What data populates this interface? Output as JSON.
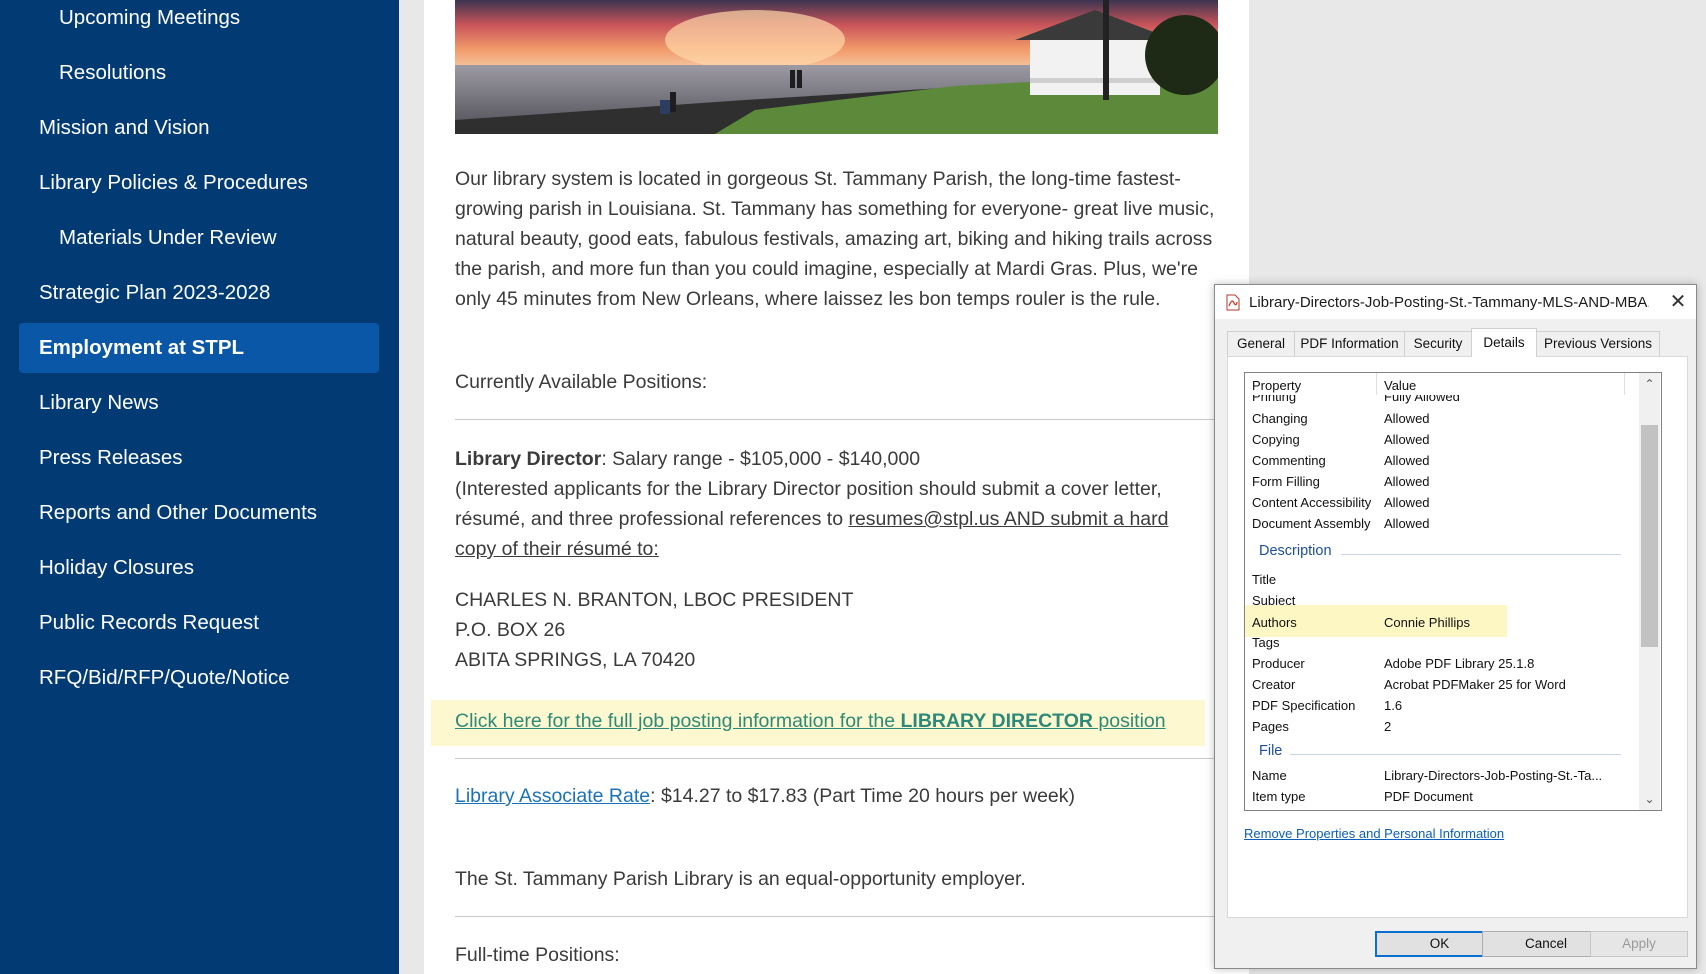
{
  "sidebar": {
    "items": [
      {
        "label": "Upcoming Meetings"
      },
      {
        "label": "Resolutions"
      },
      {
        "label": "Mission and Vision"
      },
      {
        "label": "Library Policies & Procedures"
      },
      {
        "label": "Materials Under Review"
      },
      {
        "label": "Strategic Plan 2023-2028"
      },
      {
        "label": "Employment at STPL"
      },
      {
        "label": "Library News"
      },
      {
        "label": "Press Releases"
      },
      {
        "label": "Reports and Other Documents"
      },
      {
        "label": "Holiday Closures"
      },
      {
        "label": "Public Records Request"
      },
      {
        "label": "RFQ/Bid/RFP/Quote/Notice"
      }
    ]
  },
  "content": {
    "intro": "Our library system is located in gorgeous St. Tammany Parish, the long-time fastest-growing parish in Louisiana. St. Tammany has something for everyone- great live music, natural beauty, good eats, fabulous festivals, amazing art, biking and hiking trails across the parish, and more fun than you could imagine, especially at Mardi Gras. Plus, we're only 45 minutes from New Orleans, where laissez les bon temps rouler is the rule.",
    "positions_heading": "Currently Available Positions:",
    "director": {
      "title": "Library Director",
      "salary": ": Salary range - $105,000 - $140,000",
      "instructions_pre": "(Interested applicants for the Library Director position should submit a cover letter, résumé, and three professional references to ",
      "instructions_link": "resumes@stpl.us AND submit a hard copy of their résumé to:",
      "address": [
        "CHARLES N. BRANTON, LBOC PRESIDENT",
        "P.O. BOX 26",
        "ABITA SPRINGS, LA 70420"
      ]
    },
    "job_link": {
      "pre": "Click here for the full job posting information for the ",
      "bold": "LIBRARY DIRECTOR",
      "post": " position"
    },
    "associate": {
      "link": "Library Associate Rate",
      "text": ": $14.27 to $17.83 (Part Time 20 hours per week)"
    },
    "eeo": "The St. Tammany Parish Library is an equal-opportunity employer.",
    "fulltime_heading": "Full-time Positions:"
  },
  "dialog": {
    "title": "Library-Directors-Job-Posting-St.-Tammany-MLS-AND-MBA...",
    "close": "✕",
    "tabs": [
      "General",
      "PDF Information",
      "Security",
      "Details",
      "Previous Versions"
    ],
    "active_tab": "Details",
    "columns": {
      "property": "Property",
      "value": "Value"
    },
    "rows": [
      {
        "k": "Printing",
        "v": "Fully Allowed"
      },
      {
        "k": "Changing",
        "v": "Allowed"
      },
      {
        "k": "Copying",
        "v": "Allowed"
      },
      {
        "k": "Commenting",
        "v": "Allowed"
      },
      {
        "k": "Form Filling",
        "v": "Allowed"
      },
      {
        "k": "Content Accessibility",
        "v": "Allowed"
      },
      {
        "k": "Document Assembly",
        "v": "Allowed"
      }
    ],
    "section_description": "Description",
    "desc_rows": [
      {
        "k": "Title",
        "v": ""
      },
      {
        "k": "Subject",
        "v": ""
      },
      {
        "k": "Authors",
        "v": "Connie Phillips"
      },
      {
        "k": "Tags",
        "v": ""
      },
      {
        "k": "Producer",
        "v": "Adobe PDF Library 25.1.8"
      },
      {
        "k": "Creator",
        "v": "Acrobat PDFMaker 25 for Word"
      },
      {
        "k": "PDF Specification",
        "v": "1.6"
      },
      {
        "k": "Pages",
        "v": "2"
      }
    ],
    "section_file": "File",
    "file_rows": [
      {
        "k": "Name",
        "v": "Library-Directors-Job-Posting-St.-Ta..."
      },
      {
        "k": "Item type",
        "v": "PDF Document"
      }
    ],
    "remove_link": "Remove Properties and Personal Information",
    "buttons": {
      "ok": "OK",
      "cancel": "Cancel",
      "apply": "Apply"
    }
  }
}
